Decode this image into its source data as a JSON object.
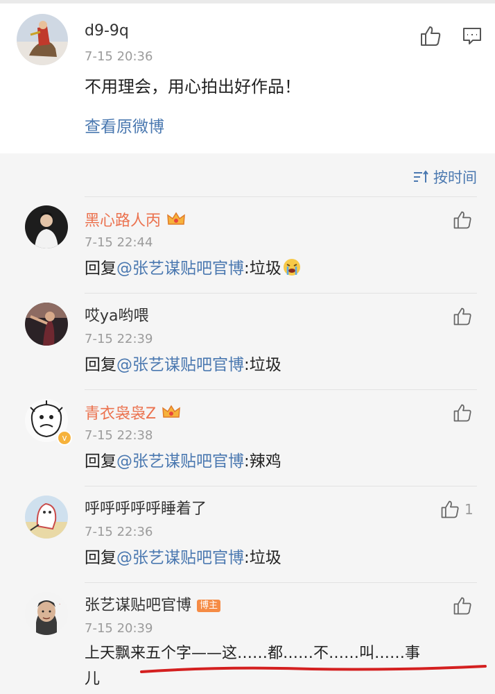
{
  "post": {
    "author": "d9-9q",
    "time": "7-15 20:36",
    "text": "不用理会，用心拍出好作品！",
    "view_original": "查看原微博"
  },
  "sort": {
    "label": "按时间"
  },
  "comments": [
    {
      "name": "黑心路人丙",
      "time": "7-15 22:44",
      "reply_prefix": "回复",
      "mention": "@张艺谋贴吧官博",
      "text": ":垃圾"
    },
    {
      "name": "哎ya哟喂",
      "time": "7-15 22:39",
      "reply_prefix": "回复",
      "mention": "@张艺谋贴吧官博",
      "text": ":垃圾"
    },
    {
      "name": "青衣袅袅Z",
      "time": "7-15 22:38",
      "reply_prefix": "回复",
      "mention": "@张艺谋贴吧官博",
      "text": ":辣鸡"
    },
    {
      "name": "呼呼呼呼呼睡着了",
      "time": "7-15 22:36",
      "reply_prefix": "回复",
      "mention": "@张艺谋贴吧官博",
      "text": ":垃圾",
      "likes": "1"
    },
    {
      "name": "张艺谋贴吧官博",
      "badge": "博主",
      "time": "7-15 20:39",
      "text_line1": "上天飘来五个字——这……都……不……叫……事",
      "text_line2": "儿"
    }
  ],
  "colors": {
    "accent_blue": "#4a78b0",
    "vip_orange": "#eb7350",
    "underline_red": "#d42020"
  }
}
